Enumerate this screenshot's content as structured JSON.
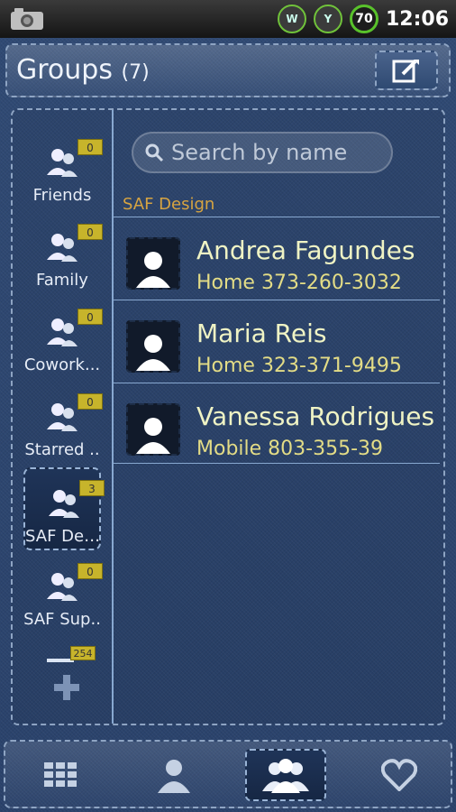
{
  "status_bar": {
    "battery_level": "70",
    "clock": "12:06",
    "icons": [
      "camera-icon",
      "wifi-icon",
      "antenna-icon",
      "battery-icon"
    ]
  },
  "header": {
    "title": "Groups",
    "count": "(7)",
    "icon": "compose-icon"
  },
  "sidebar": {
    "groups": [
      {
        "label": "Friends",
        "badge": "0",
        "selected": false
      },
      {
        "label": "Family",
        "badge": "0",
        "selected": false
      },
      {
        "label": "Cowork...",
        "badge": "0",
        "selected": false
      },
      {
        "label": "Starred ..",
        "badge": "0",
        "selected": false
      },
      {
        "label": "SAF Des...",
        "badge": "3",
        "selected": true
      },
      {
        "label": "SAF Sup..",
        "badge": "0",
        "selected": false
      }
    ],
    "extra_badge": "254",
    "add_icon": "plus-icon"
  },
  "search": {
    "placeholder": "Search by name",
    "value": ""
  },
  "group_section": {
    "title": "SAF Design"
  },
  "contacts": [
    {
      "name": "Andrea Fagundes",
      "phone": "Home 373-260-3032"
    },
    {
      "name": "Maria Reis",
      "phone": "Home 323-371-9495"
    },
    {
      "name": "Vanessa Rodrigues",
      "phone": "Mobile 803-355-39"
    }
  ],
  "bottom_tabs": [
    {
      "icon": "dialpad-icon",
      "active": false
    },
    {
      "icon": "contact-icon",
      "active": false
    },
    {
      "icon": "groups-icon",
      "active": true
    },
    {
      "icon": "favorites-icon",
      "active": false
    }
  ],
  "colors": {
    "denim": "#2d4670",
    "stitch": "#8ea4c3",
    "badge": "#c7b42b",
    "section_label": "#d7a441",
    "contact_name": "#eff3c4",
    "contact_phone": "#e3dc86"
  }
}
